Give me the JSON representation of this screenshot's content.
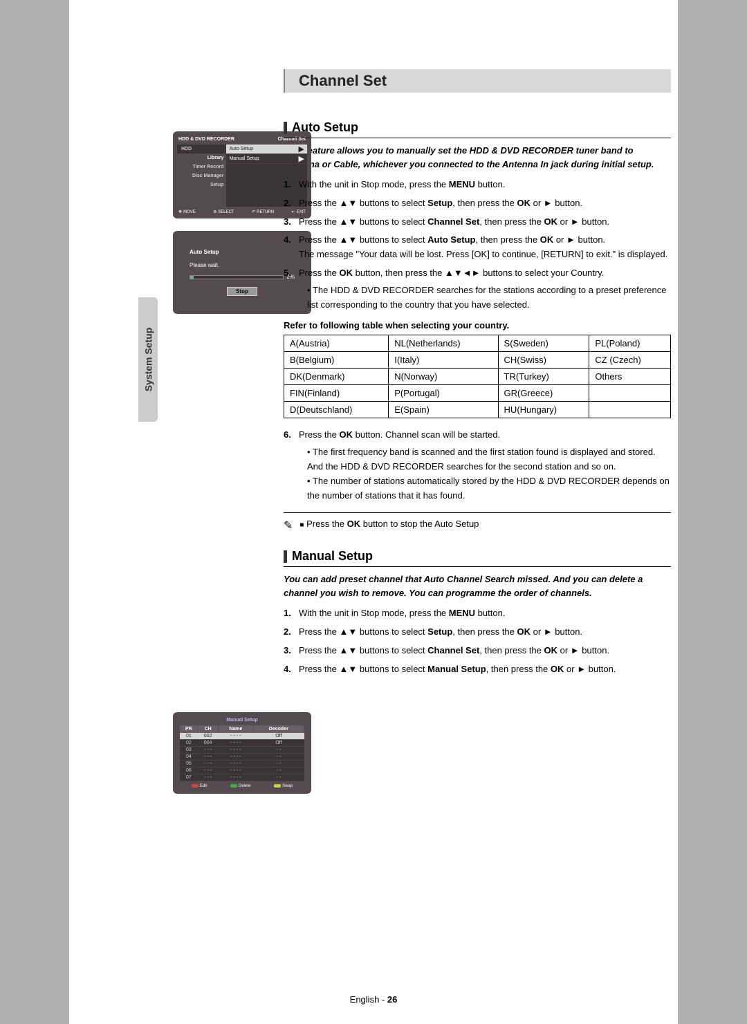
{
  "sidebar": {
    "label": "System Setup"
  },
  "osd1": {
    "header_left": "HDD & DVD RECORDER",
    "header_right": "Channel Set",
    "left": {
      "hdd": "HDD",
      "items": [
        "Library",
        "Timer Record",
        "Disc Manager",
        "Setup"
      ]
    },
    "right": {
      "rows": [
        {
          "label": "Auto Setup",
          "selected": true
        },
        {
          "label": "Manual Setup",
          "selected": false
        }
      ]
    },
    "bottom": [
      "MOVE",
      "SELECT",
      "RETURN",
      "EXIT"
    ]
  },
  "osd2": {
    "title": "Auto Setup",
    "wait": "Please wait.",
    "percent": "2%",
    "stop": "Stop"
  },
  "osd3": {
    "title": "Manual Setup",
    "headers": [
      "PR",
      "CH",
      "Name",
      "Decoder"
    ],
    "rows": [
      [
        "01",
        "002",
        "- - - -",
        "Off"
      ],
      [
        "02",
        "004",
        "- - - -",
        "Off"
      ],
      [
        "03",
        "- - -",
        "- - - -",
        "- -"
      ],
      [
        "04",
        "- - -",
        "- - - -",
        "- -"
      ],
      [
        "05",
        "- - -",
        "- - - -",
        "- -"
      ],
      [
        "06",
        "- - -",
        "- - - -",
        "- -"
      ],
      [
        "07",
        "- - -",
        "- - - -",
        "- -"
      ]
    ],
    "legend": [
      "Edit",
      "Delete",
      "Swap"
    ]
  },
  "content": {
    "title": "Channel Set",
    "auto": {
      "heading": "Auto Setup",
      "intro": "This feature allows you to manually set the HDD & DVD RECORDER tuner band to Antenna or Cable, whichever you connected to the Antenna In jack during initial setup.",
      "steps": {
        "s1": {
          "pre": "With the unit in Stop mode, press the ",
          "b1": "MENU",
          "post": " button."
        },
        "s2": {
          "pre": "Press the ▲▼ buttons to select ",
          "b1": "Setup",
          "mid": ", then press the ",
          "b2": "OK",
          "post": " or ► button."
        },
        "s3": {
          "pre": "Press the ▲▼ buttons to select ",
          "b1": "Channel Set",
          "mid": ", then press the ",
          "b2": "OK",
          "post": " or ► button."
        },
        "s4": {
          "pre": "Press the ▲▼ buttons to select ",
          "b1": "Auto Setup",
          "mid": ", then press the ",
          "b2": "OK",
          "post": " or ► button.",
          "tail": "The message \"Your data will be lost. Press [OK] to continue, [RETURN] to exit.\" is displayed."
        },
        "s5": {
          "pre": "Press the ",
          "b1": "OK",
          "post": " button, then press the ▲▼◄► buttons to select your Country.",
          "bul1": "The HDD & DVD RECORDER searches for the stations according to a preset preference list corresponding to the country that you have selected."
        },
        "ref": "Refer to following table when selecting your country.",
        "table": [
          [
            "A(Austria)",
            "NL(Netherlands)",
            "S(Sweden)",
            "PL(Poland)"
          ],
          [
            "B(Belgium)",
            "I(Italy)",
            "CH(Swiss)",
            "CZ (Czech)"
          ],
          [
            "DK(Denmark)",
            "N(Norway)",
            "TR(Turkey)",
            "Others"
          ],
          [
            "FIN(Finland)",
            "P(Portugal)",
            "GR(Greece)",
            ""
          ],
          [
            "D(Deutschland)",
            "E(Spain)",
            "HU(Hungary)",
            ""
          ]
        ],
        "s6": {
          "pre": "Press the ",
          "b1": "OK",
          "post": " button. Channel scan will be started.",
          "bul1": "The first frequency band is scanned and the first station found is displayed and stored. And the HDD & DVD RECORDER searches for the second station and so on.",
          "bul2": "The number of stations automatically stored by the HDD & DVD RECORDER depends on the number of stations that it has found."
        },
        "note": {
          "pre": "Press the ",
          "b1": "OK",
          "post": " button to stop the Auto Setup"
        }
      }
    },
    "manual": {
      "heading": "Manual Setup",
      "intro": "You can add preset channel that Auto Channel Search missed. And you can delete a channel you wish to remove. You can programme the order of channels.",
      "steps": {
        "s1": {
          "pre": "With the unit in Stop mode, press the ",
          "b1": "MENU",
          "post": " button."
        },
        "s2": {
          "pre": "Press the ▲▼ buttons to select ",
          "b1": "Setup",
          "mid": ", then press the ",
          "b2": "OK",
          "post": " or ► button."
        },
        "s3": {
          "pre": "Press the ▲▼  buttons to select ",
          "b1": "Channel Set",
          "mid": ", then press the ",
          "b2": "OK",
          "post": " or ► button."
        },
        "s4": {
          "pre": "Press the ▲▼  buttons to select ",
          "b1": "Manual Setup",
          "mid": ", then press the ",
          "b2": "OK",
          "post": " or ► button."
        }
      }
    }
  },
  "footer": {
    "lang": "English",
    "page": "26"
  }
}
